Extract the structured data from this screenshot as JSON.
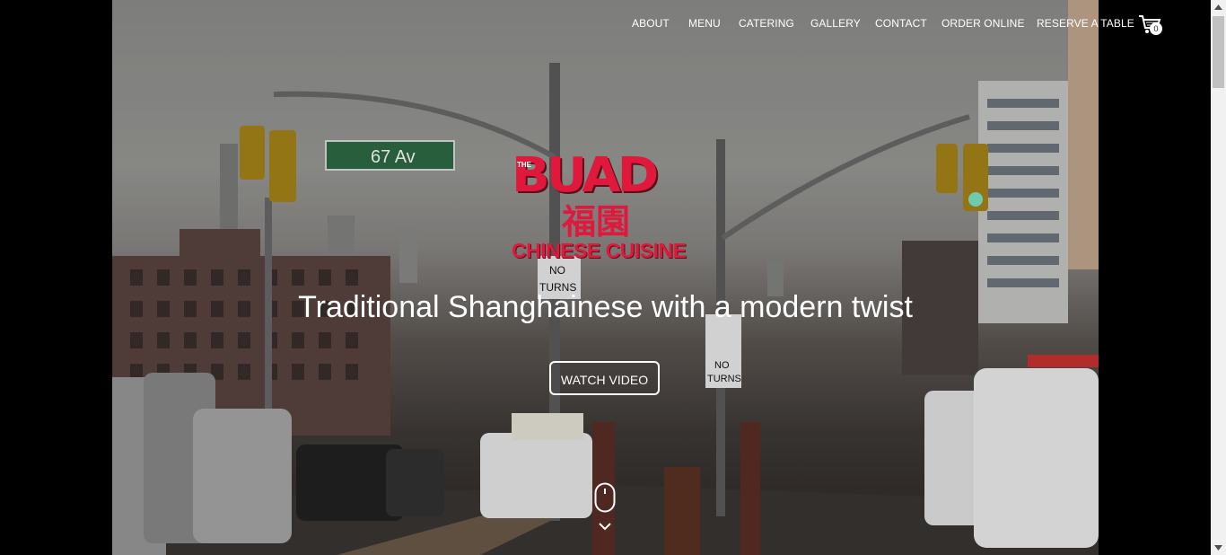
{
  "nav": {
    "items": [
      {
        "label": "ABOUT"
      },
      {
        "label": "MENU"
      },
      {
        "label": "CATERING"
      },
      {
        "label": "GALLERY"
      },
      {
        "label": "CONTACT"
      },
      {
        "label": "ORDER ONLINE"
      },
      {
        "label": "RESERVE A TABLE"
      }
    ],
    "cart_icon": "shopping-cart-icon",
    "cart_count": "0"
  },
  "logo": {
    "prefix": "THE",
    "word": "BUAD",
    "chinese": "福園",
    "subtitle": "CHINESE CUISINE",
    "color": "#e0193c"
  },
  "hero": {
    "tagline": "Traditional Shanghainese with a modern twist",
    "button_label": "WATCH VIDEO",
    "scroll_icon": "mouse-icon",
    "chevron_icon": "chevron-down-icon",
    "street_sign": "67 Av",
    "sign_no_turns": "NO TURNS"
  }
}
